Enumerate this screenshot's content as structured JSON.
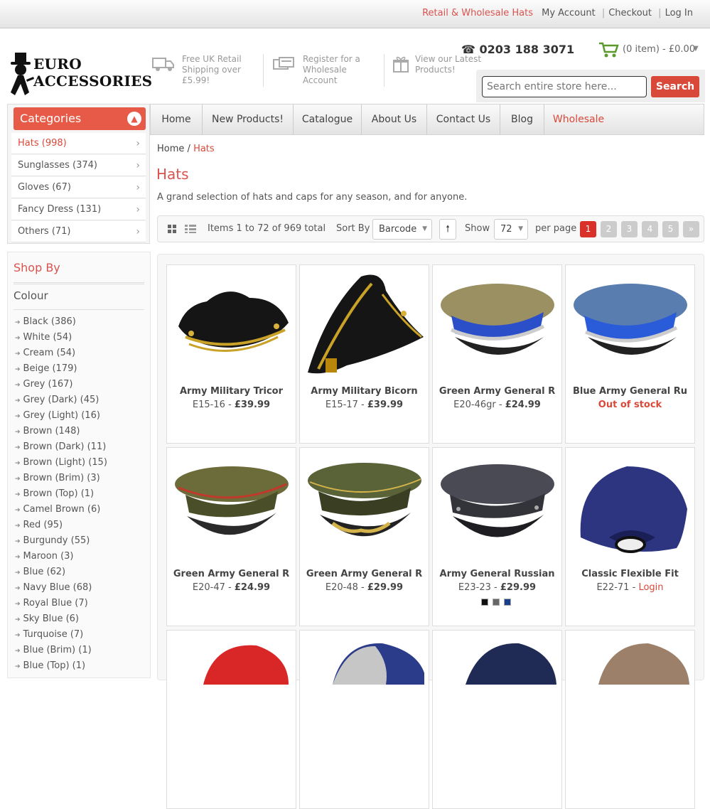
{
  "toplinks": {
    "retail": "Retail & Wholesale Hats",
    "account": "My Account",
    "checkout": "Checkout",
    "login": "Log In",
    "sep": "|"
  },
  "logo": {
    "line1": "EURO",
    "line2": "ACCESSORIES"
  },
  "features": [
    {
      "icon": "truck-icon",
      "text": "Free UK Retail Shipping over £5.99!"
    },
    {
      "icon": "cards-icon",
      "text": "Register for a Wholesale Account"
    },
    {
      "icon": "gift-icon",
      "text": "View our Latest Products!"
    }
  ],
  "phone": {
    "icon": "phone-icon",
    "number": "0203 188 3071"
  },
  "cart": {
    "icon": "cart-icon",
    "summary": "(0 item) - £0.00"
  },
  "search": {
    "placeholder": "Search entire store here...",
    "button": "Search"
  },
  "categories": {
    "title": "Categories",
    "items": [
      {
        "label": "Hats (998)",
        "active": true
      },
      {
        "label": "Sunglasses (374)"
      },
      {
        "label": "Gloves (67)"
      },
      {
        "label": "Fancy Dress (131)"
      },
      {
        "label": "Others (71)"
      }
    ]
  },
  "nav": [
    "Home",
    "New Products!",
    "Catalogue",
    "About Us",
    "Contact Us",
    "Blog",
    "Wholesale"
  ],
  "breadcrumb": {
    "home": "Home",
    "sep": "/",
    "current": "Hats"
  },
  "page": {
    "title": "Hats",
    "description": "A grand selection of hats and caps for any season, and for anyone."
  },
  "toolbar": {
    "items_text": "Items 1 to 72 of 969 total",
    "sort_label": "Sort By",
    "sort_value": "Barcode",
    "show_label": "Show",
    "show_value": "72",
    "per_page": "per page",
    "pages": [
      "1",
      "2",
      "3",
      "4",
      "5"
    ],
    "next": "»"
  },
  "sidebar": {
    "shopby": "Shop By",
    "colour": "Colour",
    "filters": [
      "Black (386)",
      "White (54)",
      "Cream (54)",
      "Beige (179)",
      "Grey (167)",
      "Grey (Dark) (45)",
      "Grey (Light) (16)",
      "Brown (148)",
      "Brown (Dark) (11)",
      "Brown (Light) (15)",
      "Brown (Brim) (3)",
      "Brown (Top) (1)",
      "Camel Brown (6)",
      "Red (95)",
      "Burgundy (55)",
      "Maroon (3)",
      "Blue (62)",
      "Navy Blue (68)",
      "Royal Blue (7)",
      "Sky Blue (6)",
      "Turquoise (7)",
      "Blue (Brim) (1)",
      "Blue (Top) (1)"
    ]
  },
  "products": [
    {
      "name": "Army Military Tricor",
      "code": "E15-16",
      "price": "£39.99"
    },
    {
      "name": "Army Military Bicorn",
      "code": "E15-17",
      "price": "£39.99"
    },
    {
      "name": "Green Army General R",
      "code": "E20-46gr",
      "price": "£24.99"
    },
    {
      "name": "Blue Army General Ru",
      "status": "Out of stock"
    },
    {
      "name": "Green Army General R",
      "code": "E20-47",
      "price": "£24.99"
    },
    {
      "name": "Green Army General R",
      "code": "E20-48",
      "price": "£29.99"
    },
    {
      "name": "Army General Russian",
      "code": "E23-23",
      "price": "£29.99",
      "swatches": [
        "#111111",
        "#666666",
        "#1a3f8a"
      ]
    },
    {
      "name": "Classic Flexible Fit",
      "code": "E22-71",
      "price_link": "Login"
    }
  ],
  "colors": {
    "accent": "#d9493a",
    "cat_header": "#e75a47"
  }
}
